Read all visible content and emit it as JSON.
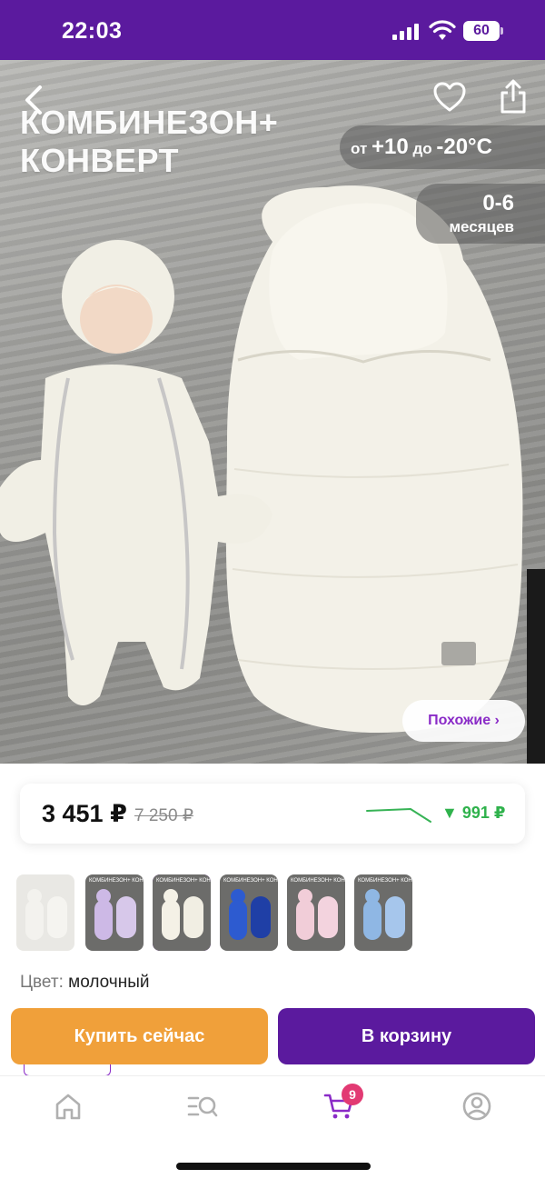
{
  "status_bar": {
    "time": "22:03",
    "battery": "60"
  },
  "hero": {
    "title_line1": "КОМБИНЕЗОН+",
    "title_line2": "КОНВЕРТ",
    "temp_prefix": "от ",
    "temp_from": "+10",
    "temp_mid": " до ",
    "temp_to": "-20°C",
    "age_range": "0-6",
    "age_unit": "месяцев",
    "similar_label": "Похожие ›"
  },
  "price": {
    "current": "3 451 ₽",
    "old": "7 250 ₽",
    "drop": "▼ 991 ₽"
  },
  "thumbnails": [
    {
      "caption": "",
      "colors": [
        "#e9e8e4",
        "#f3f2ee",
        "#f5f4f0"
      ]
    },
    {
      "caption": "КОМБИНЕЗОН+ КОНВЕРТ",
      "colors": [
        "#6c6c6a",
        "#cdb9e6",
        "#d7c8ea"
      ]
    },
    {
      "caption": "КОМБИНЕЗОН+ КОНВЕРТ",
      "colors": [
        "#6c6c6a",
        "#f4f1e6",
        "#f1eee3"
      ]
    },
    {
      "caption": "КОМБИНЕЗОН+ КОНВЕРТ",
      "colors": [
        "#6c6c6a",
        "#2d5bd0",
        "#1f3fa6"
      ]
    },
    {
      "caption": "КОМБИНЕЗОН+ КОНВЕРТ",
      "colors": [
        "#6c6c6a",
        "#f1cdd8",
        "#f3d3de"
      ]
    },
    {
      "caption": "КОМБИНЕЗОН+ КОНВЕРТ",
      "colors": [
        "#6c6c6a",
        "#8fb7e4",
        "#a6c6ec"
      ]
    }
  ],
  "color": {
    "label": "Цвет:",
    "value": "молочный"
  },
  "actions": {
    "buy_now": "Купить сейчас",
    "add_to_cart": "В корзину"
  },
  "tabbar": {
    "icons": [
      "home-icon",
      "catalog-search-icon",
      "cart-icon",
      "profile-icon"
    ],
    "cart_badge": "9"
  },
  "colors": {
    "brand_purple": "#5b1a9e",
    "accent_orange": "#f0a03a",
    "price_drop_green": "#2fb24c",
    "badge_pink": "#e23a73"
  }
}
